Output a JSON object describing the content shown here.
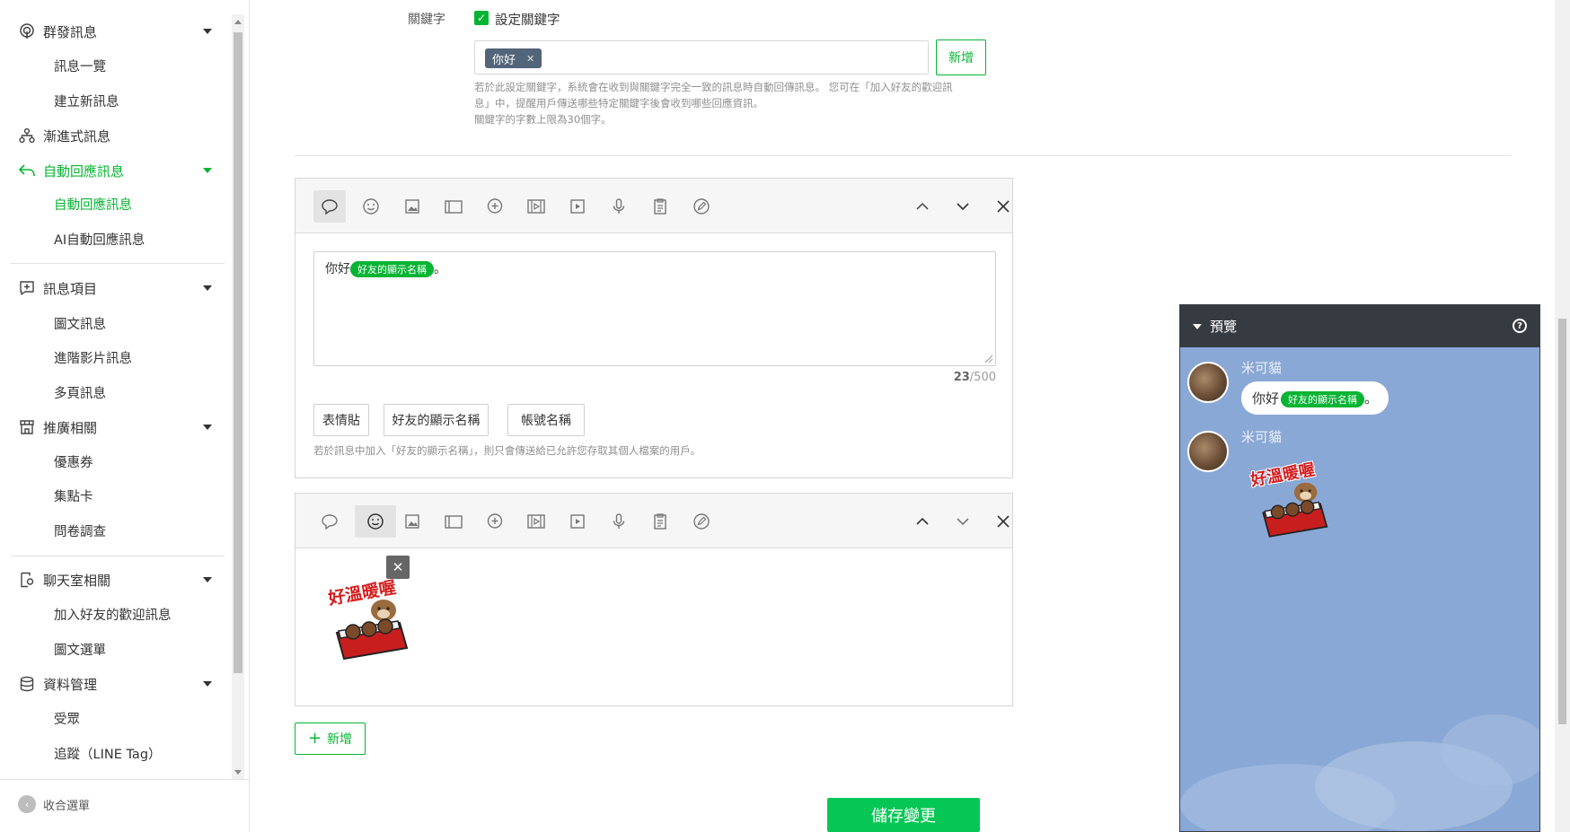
{
  "sidebar": {
    "groups": [
      {
        "label": "群發訊息",
        "icon": "broadcast-icon",
        "subs": [
          "訊息一覽",
          "建立新訊息"
        ]
      },
      {
        "label": "漸進式訊息",
        "icon": "step-flow-icon",
        "subs": []
      },
      {
        "label": "自動回應訊息",
        "icon": "reply-arrow-icon",
        "subs": [
          "自動回應訊息",
          "AI自動回應訊息"
        ]
      },
      {
        "label": "訊息項目",
        "icon": "message-plus-icon",
        "subs": [
          "圖文訊息",
          "進階影片訊息",
          "多頁訊息"
        ]
      },
      {
        "label": "推廣相關",
        "icon": "storefront-icon",
        "subs": [
          "優惠券",
          "集點卡",
          "問卷調查"
        ]
      },
      {
        "label": "聊天室相關",
        "icon": "chat-settings-icon",
        "subs": [
          "加入好友的歡迎訊息",
          "圖文選單"
        ]
      },
      {
        "label": "資料管理",
        "icon": "database-icon",
        "subs": [
          "受眾",
          "追蹤（LINE Tag）"
        ]
      }
    ],
    "collapse_label": "收合選單"
  },
  "keyword": {
    "label": "關鍵字",
    "checkbox_label": "設定關鍵字",
    "checked": true,
    "tags": [
      "你好"
    ],
    "add_button": "新增",
    "help_lines": [
      "若於此設定關鍵字，系統會在收到與關鍵字完全一致的訊息時自動回傳訊息。 您可在「加入好友的歡迎訊",
      "息」中，提醒用戶傳送哪些特定關鍵字後會收到哪些回應資訊。",
      "關鍵字的字數上限為30個字。"
    ]
  },
  "message1": {
    "text_before": "你好",
    "chip": "好友的顯示名稱",
    "text_after": "。",
    "count_current": "23",
    "count_max": "/500",
    "buttons": [
      "表情貼",
      "好友的顯示名稱",
      "帳號名稱"
    ],
    "help": "若於訊息中加入「好友的顯示名稱」，則只會傳送給已允許您存取其個人檔案的用戶。"
  },
  "message2": {
    "sticker_text": "好溫暖喔"
  },
  "add_message_button": "新增",
  "save_button": "儲存變更",
  "preview": {
    "title": "預覽",
    "sender": "米可貓",
    "bubble_text": "你好",
    "bubble_chip": "好友的顯示名稱",
    "bubble_after": "。",
    "sticker_text": "好溫暖喔"
  },
  "colors": {
    "accent": "#06b433",
    "save": "#06c755",
    "preview_bg": "#8aa8d5",
    "preview_header": "#363b42"
  }
}
